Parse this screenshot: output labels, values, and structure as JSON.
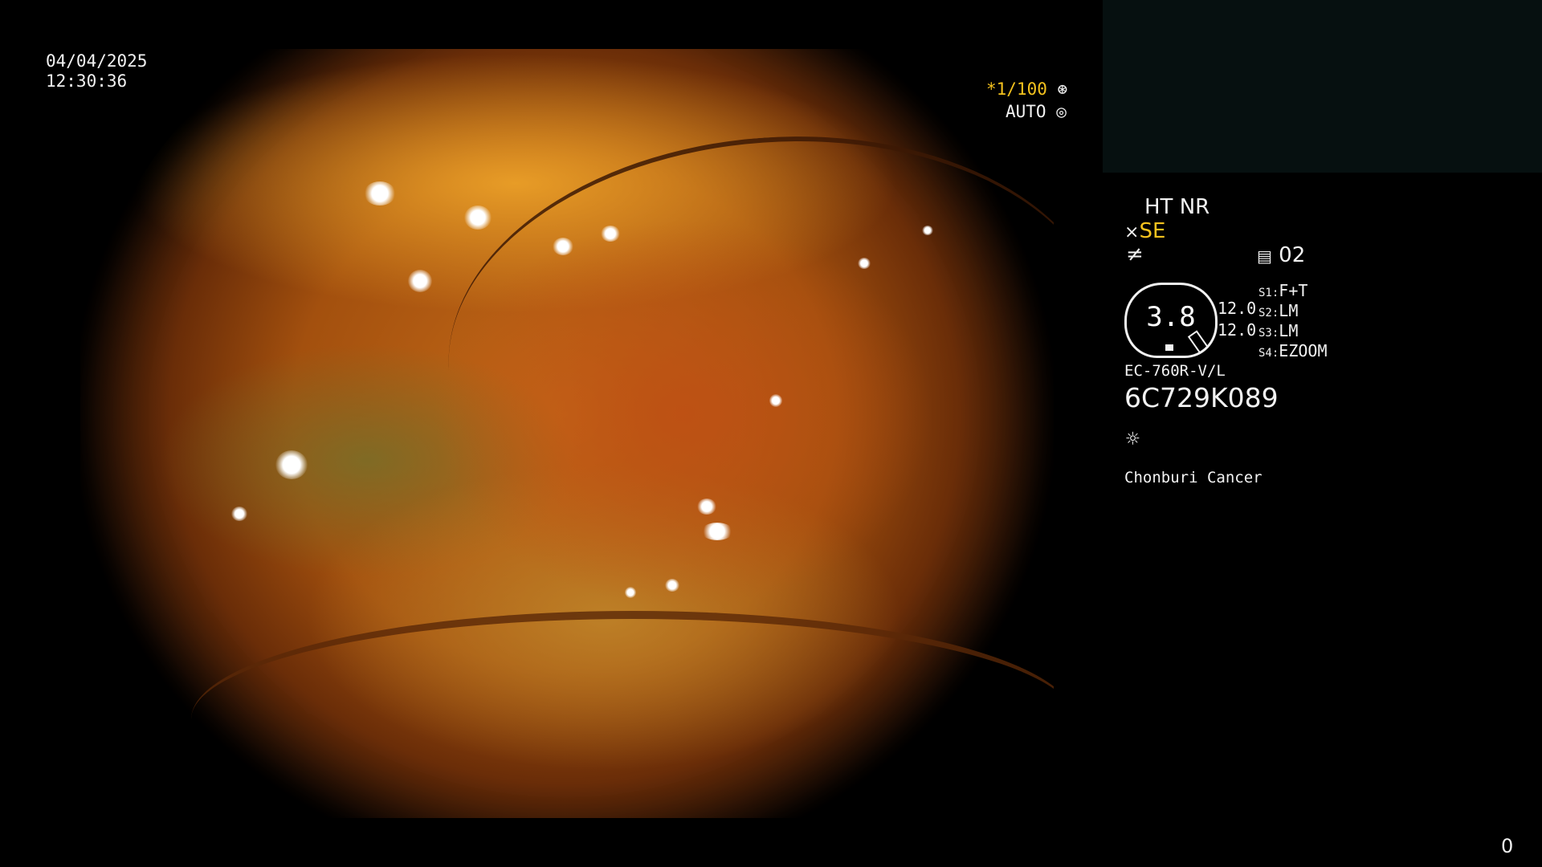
{
  "datetime": {
    "date": "04/04/2025",
    "time": "12:30:36"
  },
  "exposure": {
    "shutter": "*1/100",
    "shutter_icon": "aperture-icon",
    "mode": "AUTO",
    "mode_icon": "iris-icon"
  },
  "settings": {
    "ht_nr": "HT NR",
    "se": "SE",
    "se_icon": "enhance-icon",
    "f_icon": "f-script-icon",
    "memory_icon": "memory-icon",
    "memory": "02",
    "gauge_value": "3.8",
    "gauge_left_1": "12.0",
    "gauge_left_2": "12.0",
    "s1_label": "S1:",
    "s1_value": "F+T",
    "s2_label": "S2:",
    "s2_value": "LM",
    "s3_label": "S3:",
    "s3_value": "LM",
    "s4_label": "S4:",
    "s4_value": "EZOOM"
  },
  "device": {
    "model": "EC-760R-V/L",
    "serial": "6C729K089",
    "light_icon": "sun-icon",
    "institution": "Chonburi Cancer"
  },
  "counter": "0"
}
